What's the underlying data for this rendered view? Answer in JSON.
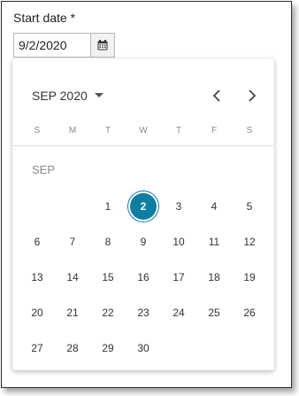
{
  "field": {
    "label": "Start date *",
    "value": "9/2/2020",
    "icon": "calendar-icon"
  },
  "calendar": {
    "month_select_label": "SEP 2020",
    "prev_icon": "chevron-left-icon",
    "next_icon": "chevron-right-icon",
    "weekdays": [
      "S",
      "M",
      "T",
      "W",
      "T",
      "F",
      "S"
    ],
    "month_label": "SEP",
    "leading_blanks": 2,
    "days": [
      "1",
      "2",
      "3",
      "4",
      "5",
      "6",
      "7",
      "8",
      "9",
      "10",
      "11",
      "12",
      "13",
      "14",
      "15",
      "16",
      "17",
      "18",
      "19",
      "20",
      "21",
      "22",
      "23",
      "24",
      "25",
      "26",
      "27",
      "28",
      "29",
      "30"
    ],
    "selected_day": "2",
    "accent_color": "#0d7ea2"
  }
}
